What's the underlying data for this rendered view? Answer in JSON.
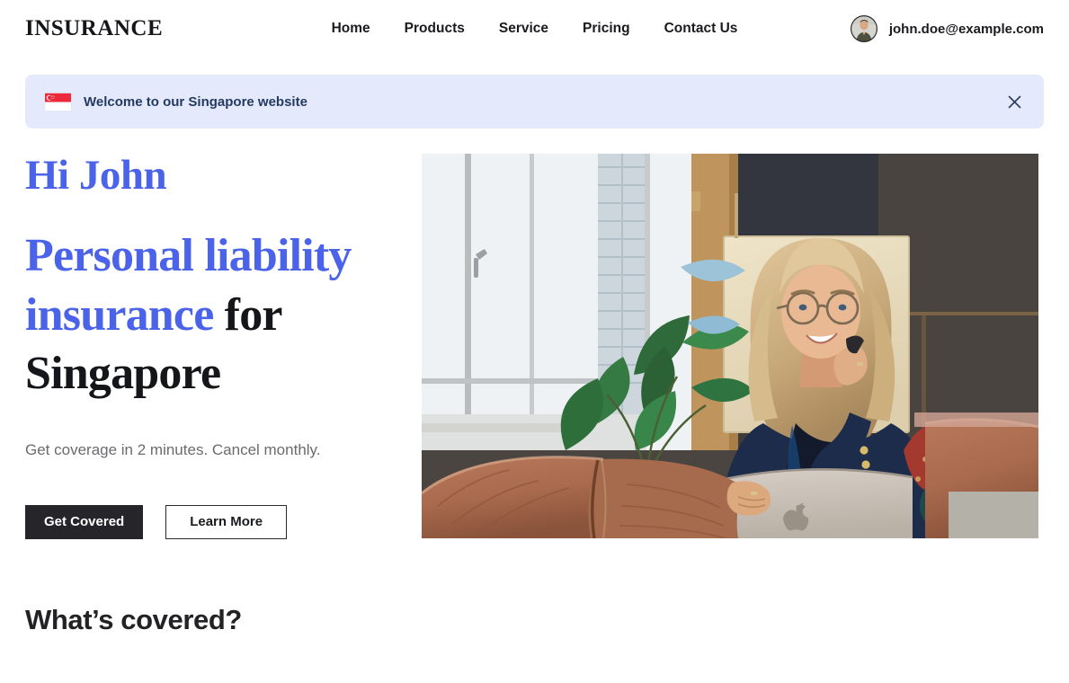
{
  "header": {
    "logo": "INSURANCE",
    "nav": [
      {
        "label": "Home"
      },
      {
        "label": "Products"
      },
      {
        "label": "Service"
      },
      {
        "label": "Pricing"
      },
      {
        "label": "Contact Us"
      }
    ],
    "user": {
      "email": "john.doe@example.com",
      "avatar_icon": "user-avatar-photo"
    }
  },
  "banner": {
    "flag_icon": "singapore-flag-icon",
    "message": "Welcome to our Singapore website",
    "close_icon": "close-icon",
    "background_color": "#e4eafb",
    "text_color": "#243a63"
  },
  "hero": {
    "greeting": "Hi John",
    "headline_part1": "Personal liability insurance",
    "headline_part2": " for Singapore",
    "subtext": "Get coverage in 2 minutes. Cancel monthly.",
    "primary_cta": "Get Covered",
    "secondary_cta": "Learn More",
    "image_alt": "woman-on-phone-with-laptop-photo",
    "accent_color": "#4a63e8",
    "primary_button_color": "#26262a"
  },
  "section": {
    "heading": "What’s covered?"
  }
}
